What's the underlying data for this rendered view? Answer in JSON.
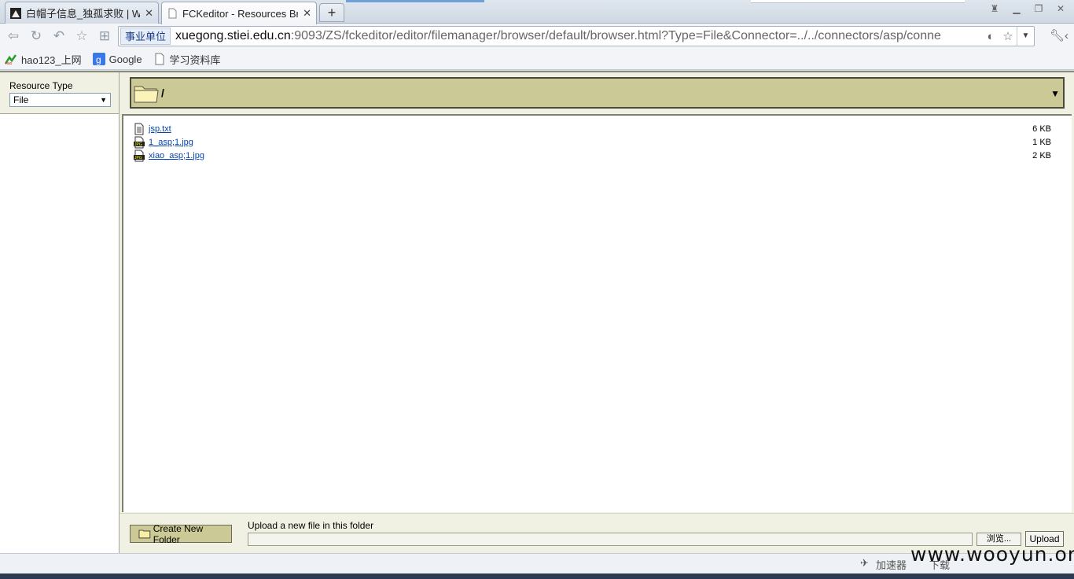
{
  "browser": {
    "tabs": [
      {
        "label": "白帽子信息_独孤求败 | Wor",
        "close": "✕",
        "icon": "hacker-icon"
      },
      {
        "label": "FCKeditor - Resources Br",
        "close": "✕",
        "icon": "page-icon"
      }
    ],
    "new_tab": "+",
    "nav": {
      "badge": "事业单位",
      "url_host": "xuegong.stiei.edu.cn",
      "url_rest": ":9093/ZS/fckeditor/editor/filemanager/browser/default/browser.html?Type=File&Connector=../../connectors/asp/conne"
    },
    "bookmarks": [
      {
        "label": "hao123_上网",
        "icon": "hao123-icon"
      },
      {
        "label": "Google",
        "icon": "google-icon"
      },
      {
        "label": "学习资料库",
        "icon": "page-icon"
      }
    ]
  },
  "fck": {
    "resource_type_label": "Resource Type",
    "resource_type_value": "File",
    "current_folder": "/",
    "files": [
      {
        "name": "jsp.txt",
        "size": "6 KB",
        "icon": "text-file-icon"
      },
      {
        "name": "1_asp;1.jpg",
        "size": "1 KB",
        "icon": "jpg-file-icon"
      },
      {
        "name": "xiao_asp;1.jpg",
        "size": "2 KB",
        "icon": "jpg-file-icon"
      }
    ],
    "create_folder_label": "Create New Folder",
    "upload_label": "Upload a new file in this folder",
    "browse_label": "浏览...",
    "upload_button": "Upload"
  },
  "statusbar": {
    "accelerator": "加速器",
    "download": "下载"
  },
  "watermark": "www.wooyun.org",
  "colors": {
    "folderbar": "#cbc995",
    "link": "#0645ad",
    "frame_bg": "#f1f1e3"
  }
}
